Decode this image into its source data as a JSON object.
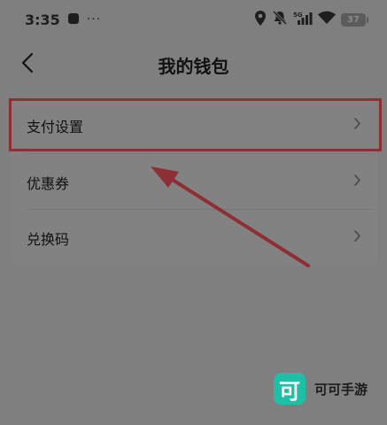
{
  "status_bar": {
    "time": "3:35",
    "notification_dots": "···",
    "battery_level": "37",
    "icons": [
      "location-icon",
      "mute-icon",
      "signal-5g-icon",
      "wifi-icon",
      "battery-icon"
    ]
  },
  "nav": {
    "title": "我的钱包",
    "back_icon": "chevron-left-icon"
  },
  "menu": {
    "items": [
      {
        "label": "支付设置",
        "icon": "chevron-right-icon"
      },
      {
        "label": "优惠券",
        "icon": "chevron-right-icon"
      },
      {
        "label": "兑换码",
        "icon": "chevron-right-icon"
      }
    ]
  },
  "annotation": {
    "highlight_color": "#8e2f35",
    "target": "支付设置"
  },
  "watermark": {
    "logo_text": "可",
    "text": "可可手游",
    "brand_color": "#1dbfa6"
  }
}
